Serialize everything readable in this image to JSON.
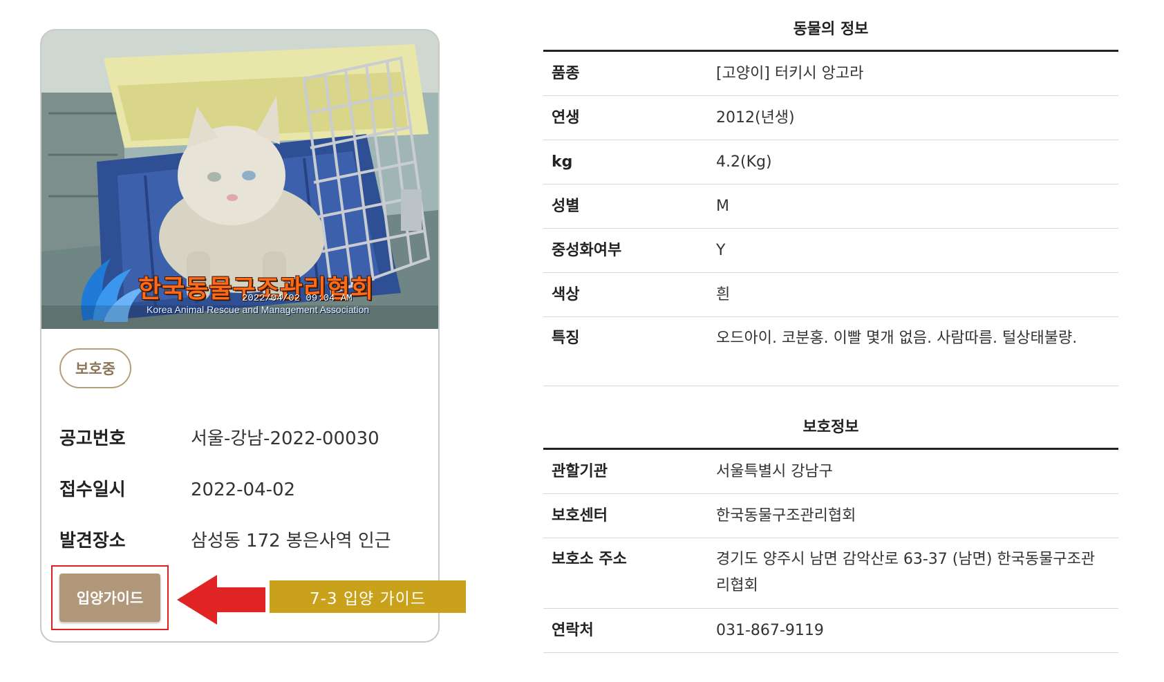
{
  "card": {
    "photo": {
      "watermark_ko": "한국동물구조관리협회",
      "watermark_en": "Korea Animal Rescue and Management Association",
      "watermark_stamp": "2022/04/02 09:04 AM"
    },
    "status_badge": "보호중",
    "rows": [
      {
        "label": "공고번호",
        "value": "서울-강남-2022-00030"
      },
      {
        "label": "접수일시",
        "value": "2022-04-02"
      },
      {
        "label": "발견장소",
        "value": "삼성동 172 봉은사역 인근"
      }
    ],
    "adopt_button": "입양가이드"
  },
  "annotation": {
    "label": "7-3 입양 가이드"
  },
  "animal_info": {
    "title": "동물의 정보",
    "rows": [
      {
        "key": "품종",
        "value": "[고양이] 터키시 앙고라"
      },
      {
        "key": "연생",
        "value": "2012(년생)"
      },
      {
        "key": "kg",
        "value": "4.2(Kg)"
      },
      {
        "key": "성별",
        "value": "M"
      },
      {
        "key": "중성화여부",
        "value": "Y"
      },
      {
        "key": "색상",
        "value": "흰"
      },
      {
        "key": "특징",
        "value": "오드아이. 코분홍. 이빨 몇개 없음. 사람따름. 털상태불량."
      }
    ]
  },
  "shelter_info": {
    "title": "보호정보",
    "rows": [
      {
        "key": "관할기관",
        "value": "서울특별시 강남구"
      },
      {
        "key": "보호센터",
        "value": "한국동물구조관리협회"
      },
      {
        "key": "보호소 주소",
        "value": "경기도 양주시 남면 감악산로 63-37 (남면) 한국동물구조관리협회"
      },
      {
        "key": "연락처",
        "value": "031-867-9119"
      }
    ]
  },
  "colors": {
    "badge_border": "#b59d7c",
    "button_bg": "#b0977a",
    "highlight_red": "#e02020",
    "annotation_bg": "#c9a11b"
  }
}
